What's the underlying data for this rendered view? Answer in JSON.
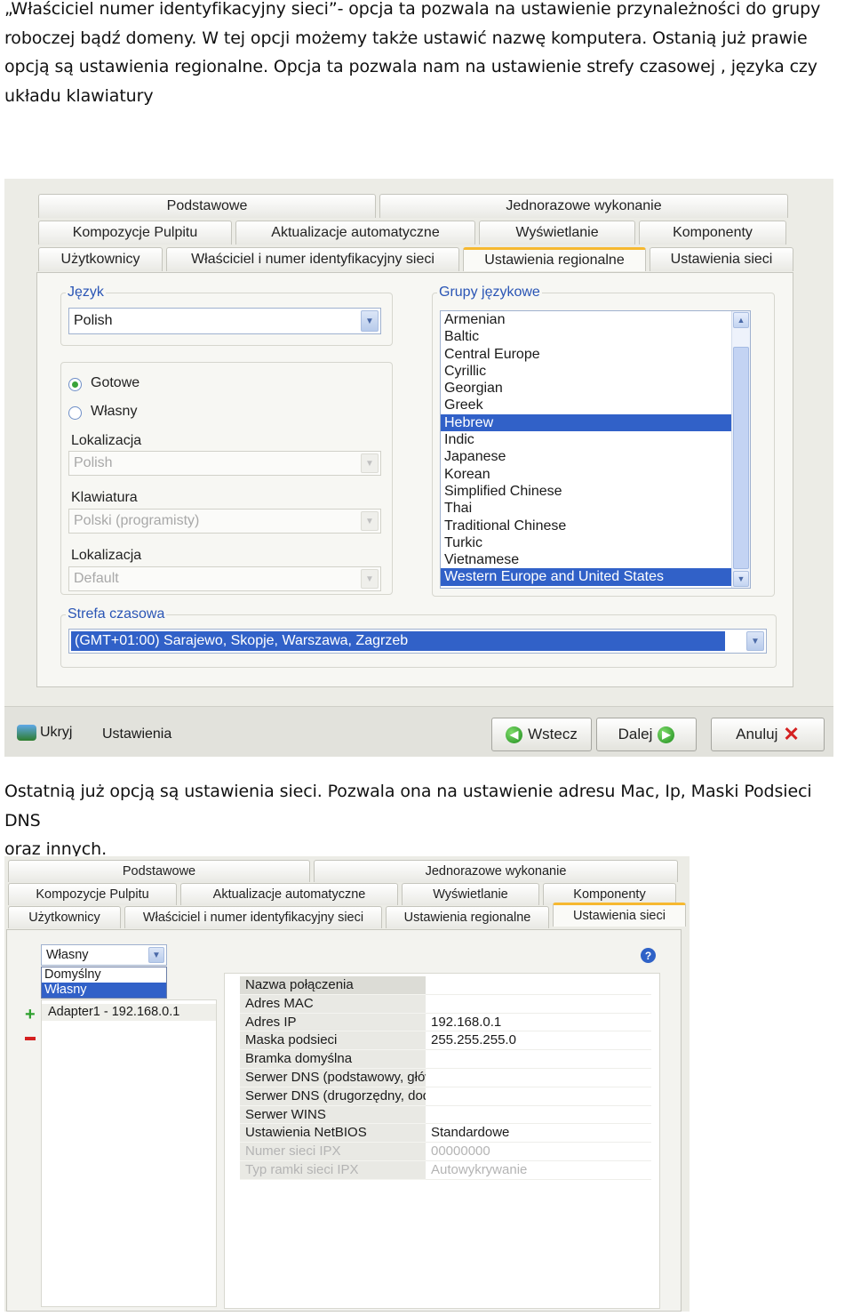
{
  "paragraph1": [
    "„Właściciel numer identyfikacyjny sieci”- opcja ta pozwala na ustawienie przynależności do grupy",
    "roboczej bądź domeny.  W tej opcji możemy także ustawić nazwę komputera.  Ostanią już prawie",
    "opcją są ustawienia regionalne. Opcja ta pozwala nam na ustawienie strefy czasowej , języka czy",
    "układu klawiatury"
  ],
  "paragraph2": [
    "Ostatnią już opcją są ustawienia sieci. Pozwala ona na ustawienie adresu Mac, Ip, Maski Podsieci DNS",
    "oraz innych."
  ],
  "tabs": {
    "podstawowe": "Podstawowe",
    "jednorazowe": "Jednorazowe wykonanie",
    "kompozycje": "Kompozycje Pulpitu",
    "aktualizacje": "Aktualizacje automatyczne",
    "wyswietlanie": "Wyświetlanie",
    "komponenty": "Komponenty",
    "uzytkownicy": "Użytkownicy",
    "wlasciciel": "Właściciel i numer identyfikacyjny sieci",
    "regionalne": "Ustawienia regionalne",
    "sieci": "Ustawienia sieci"
  },
  "regional": {
    "jezyk_label": "Język",
    "jezyk_value": "Polish",
    "gotowe_label": "Gotowe",
    "wlasny_label": "Własny",
    "lokalizacja_label": "Lokalizacja",
    "lokalizacja_value": "Polish",
    "klawiatura_label": "Klawiatura",
    "klawiatura_value": "Polski (programisty)",
    "lokalizacja2_label": "Lokalizacja",
    "lokalizacja2_value": "Default",
    "grupy_label": "Grupy językowe",
    "grupy_items": [
      "Armenian",
      "Baltic",
      "Central Europe",
      "Cyrillic",
      "Georgian",
      "Greek",
      "Hebrew",
      "Indic",
      "Japanese",
      "Korean",
      "Simplified Chinese",
      "Thai",
      "Traditional Chinese",
      "Turkic",
      "Vietnamese",
      "Western Europe and United States"
    ],
    "strefa_label": "Strefa czasowa",
    "strefa_value": "(GMT+01:00) Sarajewo, Skopje, Warszawa, Zagrzeb"
  },
  "bottom_bar": {
    "ukryj": "Ukryj",
    "ustawienia": "Ustawienia",
    "wstecz": "Wstecz",
    "dalej": "Dalej",
    "anuluj": "Anuluj"
  },
  "network": {
    "profile_value": "Własny",
    "profile_options": [
      "Domyślny",
      "Własny"
    ],
    "adapter": "Adapter1 - 192.168.0.1",
    "rows": [
      {
        "name": "Nazwa połączenia",
        "value": ""
      },
      {
        "name": "Adres MAC",
        "value": ""
      },
      {
        "name": "Adres IP",
        "value": "192.168.0.1"
      },
      {
        "name": "Maska podsieci",
        "value": "255.255.255.0"
      },
      {
        "name": "Bramka domyślna",
        "value": ""
      },
      {
        "name": "Serwer DNS (podstawowy, główn",
        "value": ""
      },
      {
        "name": "Serwer DNS (drugorzędny, dodat",
        "value": ""
      },
      {
        "name": "Serwer WINS",
        "value": ""
      },
      {
        "name": "Ustawienia NetBIOS",
        "value": "Standardowe"
      },
      {
        "name": "Numer sieci IPX",
        "value": "00000000"
      },
      {
        "name": "Typ ramki sieci IPX",
        "value": "Autowykrywanie"
      }
    ]
  },
  "colors": {
    "selection": "#3161c8",
    "group_label": "#2a55b5",
    "active_tab_accent": "#f6b830"
  }
}
